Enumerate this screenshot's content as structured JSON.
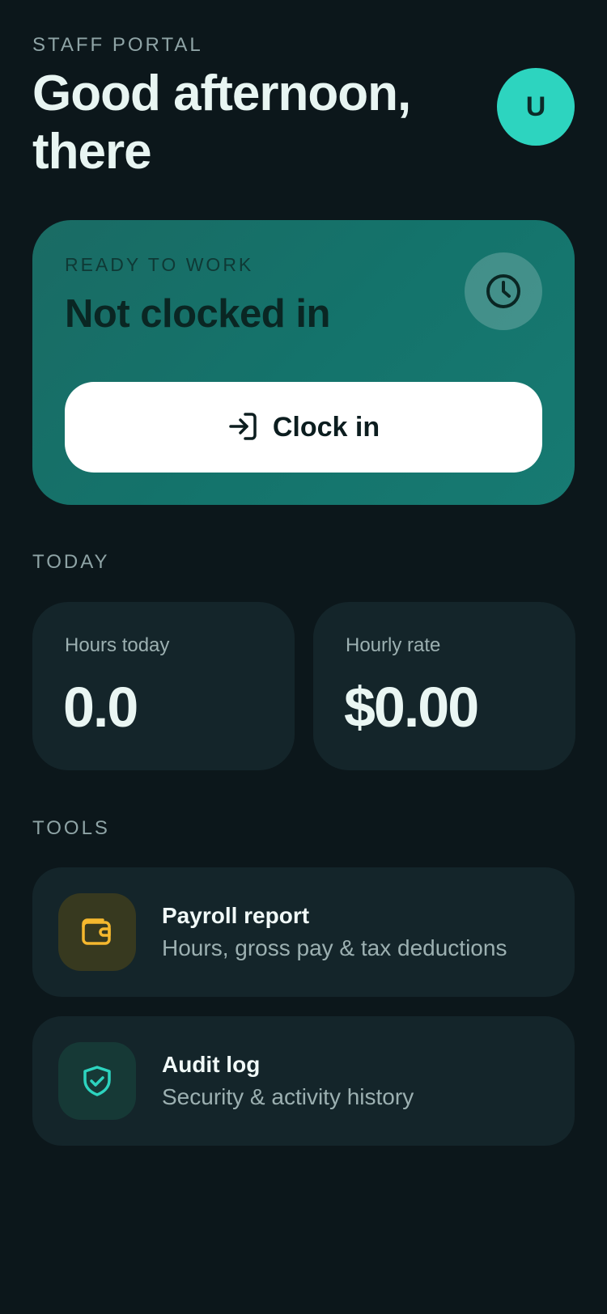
{
  "header": {
    "portal_label": "STAFF PORTAL",
    "greeting": "Good afternoon, there",
    "avatar_initial": "U"
  },
  "status_card": {
    "kicker": "READY TO WORK",
    "title": "Not clocked in",
    "icon": "clock-icon",
    "button_label": "Clock in",
    "button_icon": "log-in-icon"
  },
  "today": {
    "section_label": "TODAY",
    "stats": [
      {
        "label": "Hours today",
        "value": "0.0"
      },
      {
        "label": "Hourly rate",
        "value": "$0.00"
      }
    ]
  },
  "tools": {
    "section_label": "TOOLS",
    "items": [
      {
        "title": "Payroll report",
        "subtitle": "Hours, gross pay & tax deductions",
        "icon": "wallet-icon",
        "accent": "#f5b82e"
      },
      {
        "title": "Audit log",
        "subtitle": "Security & activity history",
        "icon": "shield-check-icon",
        "accent": "#2dd4bf"
      }
    ]
  },
  "colors": {
    "background": "#0c171b",
    "card": "#14252a",
    "accent_teal": "#2dd4bf",
    "status_card": "#177a72"
  }
}
